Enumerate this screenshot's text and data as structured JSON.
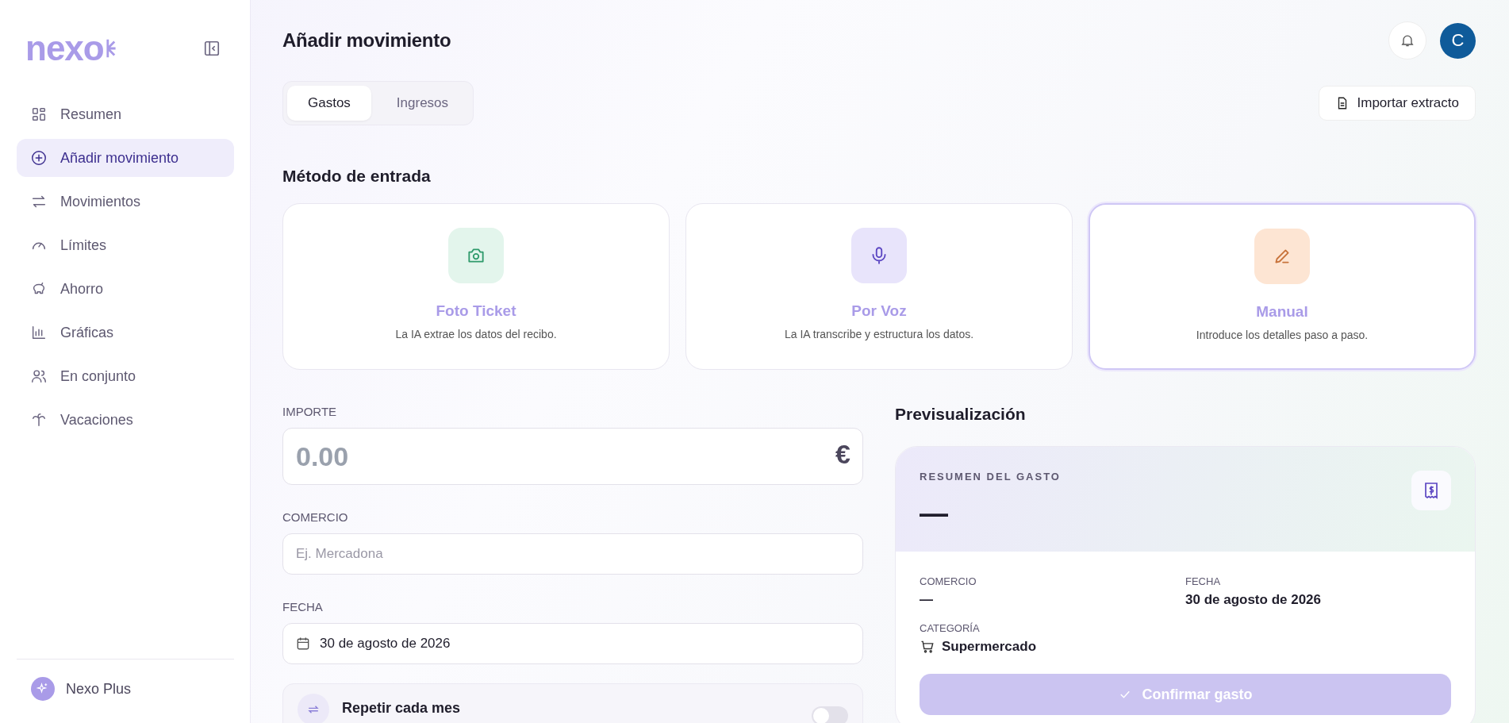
{
  "sidebar": {
    "logo": "nexo",
    "items": [
      {
        "label": "Resumen",
        "selected": false
      },
      {
        "label": "Añadir movimiento",
        "selected": true
      },
      {
        "label": "Movimientos",
        "selected": false
      },
      {
        "label": "Límites",
        "selected": false
      },
      {
        "label": "Ahorro",
        "selected": false
      },
      {
        "label": "Gráficas",
        "selected": false
      },
      {
        "label": "En conjunto",
        "selected": false
      },
      {
        "label": "Vacaciones",
        "selected": false
      }
    ],
    "footer": "Nexo Plus"
  },
  "header": {
    "title": "Añadir movimiento",
    "avatar": "C"
  },
  "tabs": [
    {
      "label": "Gastos",
      "selected": true
    },
    {
      "label": "Ingresos",
      "selected": false
    }
  ],
  "import_button": "Importar extracto",
  "method_title": "Método de entrada",
  "methods": [
    {
      "title": "Foto Ticket",
      "description": "La IA extrae los datos del recibo.",
      "selected": false
    },
    {
      "title": "Por Voz",
      "description": "La IA transcribe y estructura los datos.",
      "selected": false
    },
    {
      "title": "Manual",
      "description": "Introduce los detalles paso a paso.",
      "selected": true
    }
  ],
  "form": {
    "amount": {
      "label": "IMPORTE",
      "placeholder": "0.00",
      "currency": "€"
    },
    "merchant": {
      "label": "COMERCIO",
      "placeholder": "Ej. Mercadona"
    },
    "date": {
      "label": "FECHA",
      "value": "30 de agosto de 2026"
    },
    "repeat": {
      "label": "Repetir cada mes",
      "on": false
    }
  },
  "preview": {
    "title": "Previsualización",
    "summary_label": "RESUMEN DEL GASTO",
    "amount": "—",
    "fields": [
      {
        "label": "COMERCIO",
        "value": "—"
      },
      {
        "label": "FECHA",
        "value": "30 de agosto de 2026"
      },
      {
        "label": "CATEGORÍA",
        "value": "Supermercado"
      }
    ],
    "confirm": {
      "label": "Confirmar gasto",
      "disabled": true
    }
  }
}
